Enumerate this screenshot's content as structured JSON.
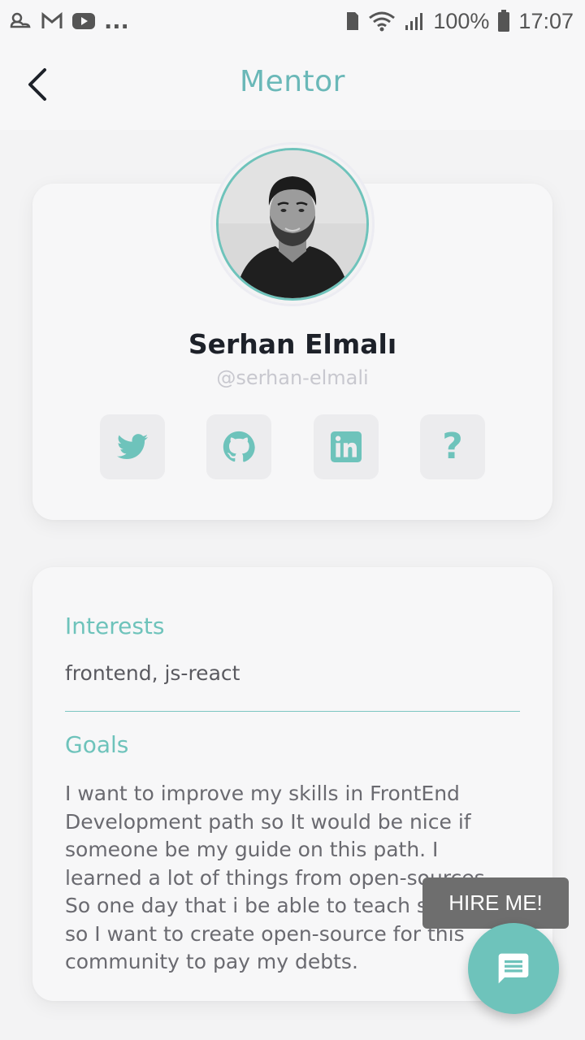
{
  "status_bar": {
    "battery_percent": "100%",
    "time": "17:07",
    "overflow": "...",
    "left_icons": [
      "weather-icon",
      "gmail-icon",
      "youtube-icon"
    ],
    "right_icons": [
      "sim-icon",
      "wifi-icon",
      "signal-icon",
      "battery-icon"
    ]
  },
  "header": {
    "title": "Mentor",
    "back_icon": "chevron-left-icon"
  },
  "profile": {
    "name": "Serhan Elmalı",
    "handle": "@serhan-elmali",
    "social_links": [
      {
        "icon": "twitter-icon"
      },
      {
        "icon": "github-icon"
      },
      {
        "icon": "linkedin-icon"
      },
      {
        "icon": "question-icon",
        "label": "?"
      }
    ]
  },
  "details": {
    "interests_title": "Interests",
    "interests_value": "frontend, js-react",
    "goals_title": "Goals",
    "goals_value": "I want to improve my skills in FrontEnd Development path so It would be nice if someone be my guide on this path. I learned a lot of things from open-sources. So one day that i be able to teach someone, so I want to create open-source for this community to pay my debts."
  },
  "hire": {
    "label": "HIRE ME!"
  },
  "chat_button": {
    "icon": "chat-icon"
  },
  "colors": {
    "accent": "#6ec3bb",
    "title": "#6ab8b8",
    "text_dark": "#1d2129",
    "handle": "#c8c8cf",
    "background": "#f7f7f8",
    "hire_badge": "#6e6e6e"
  }
}
